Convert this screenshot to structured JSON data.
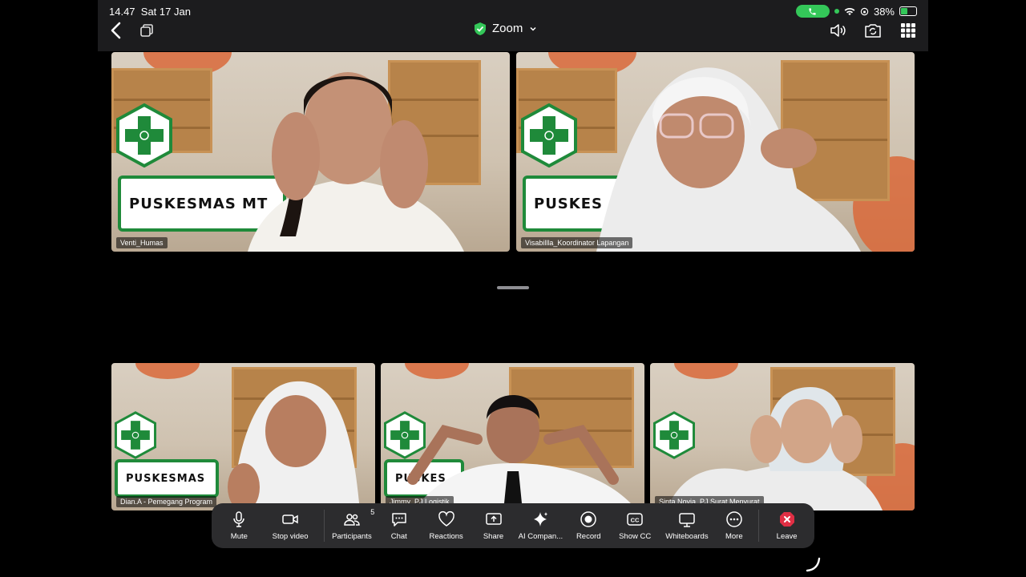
{
  "status_bar": {
    "time": "14.47",
    "date": "Sat 17 Jan",
    "battery": "38%"
  },
  "nav": {
    "title": "Zoom"
  },
  "tiles": [
    {
      "name": "Venti_Humas",
      "banner": "PUSKESMAS MT"
    },
    {
      "name": "Visabillla_Koordinator Lapangan",
      "banner": "PUSKES"
    },
    {
      "name": "Dian.A - Pemegang Program",
      "banner": "PUSKESMAS"
    },
    {
      "name": "Jimmy_PJ Logistik",
      "banner": "PUSKES"
    },
    {
      "name": "Sinta Novia_PJ Surat Menyurat",
      "banner": ""
    }
  ],
  "toolbar": {
    "mute": "Mute",
    "stop_video": "Stop video",
    "participants": "Participants",
    "participants_count": "5",
    "chat": "Chat",
    "reactions": "Reactions",
    "share": "Share",
    "ai_companion": "AI Compan...",
    "record": "Record",
    "show_cc": "Show CC",
    "whiteboards": "Whiteboards",
    "more": "More",
    "leave": "Leave"
  },
  "colors": {
    "accent_green": "#34c759",
    "puskesmas_green": "#1f8a3a",
    "leave_red": "#e02f44",
    "toolbar_bg": "#2c2c2e"
  }
}
